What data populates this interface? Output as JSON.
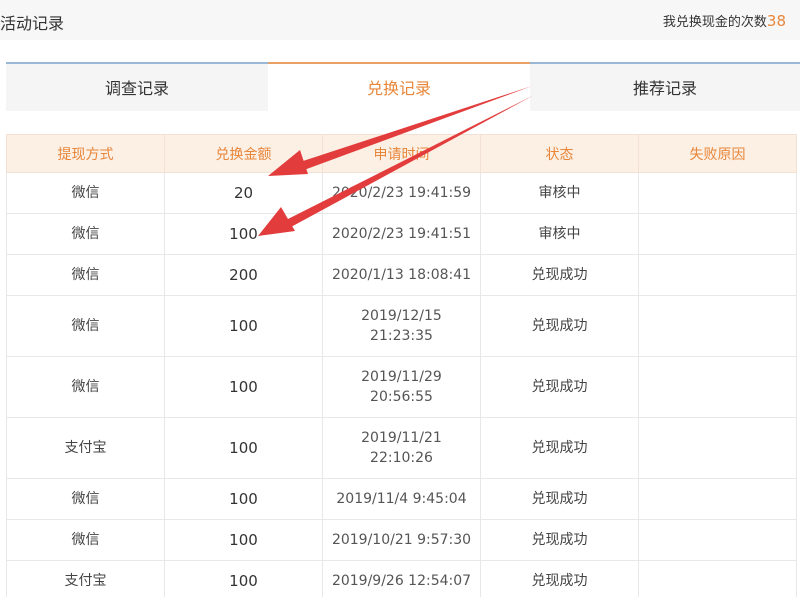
{
  "header": {
    "title": "活动记录",
    "count_label": "我兑换现金的次数",
    "count_value": "38"
  },
  "tabs": [
    {
      "label": "调查记录"
    },
    {
      "label": "兑换记录"
    },
    {
      "label": "推荐记录"
    }
  ],
  "table": {
    "columns": [
      "提现方式",
      "兑换金额",
      "申请时间",
      "状态",
      "失败原因"
    ],
    "rows": [
      {
        "method": "微信",
        "amount": "20",
        "time_line1": "2020/2/23 19:41:59",
        "time_line2": "",
        "status": "审核中",
        "reason": ""
      },
      {
        "method": "微信",
        "amount": "100",
        "time_line1": "2020/2/23 19:41:51",
        "time_line2": "",
        "status": "审核中",
        "reason": ""
      },
      {
        "method": "微信",
        "amount": "200",
        "time_line1": "2020/1/13 18:08:41",
        "time_line2": "",
        "status": "兑现成功",
        "reason": ""
      },
      {
        "method": "微信",
        "amount": "100",
        "time_line1": "2019/12/15",
        "time_line2": "21:23:35",
        "status": "兑现成功",
        "reason": ""
      },
      {
        "method": "微信",
        "amount": "100",
        "time_line1": "2019/11/29",
        "time_line2": "20:56:55",
        "status": "兑现成功",
        "reason": ""
      },
      {
        "method": "支付宝",
        "amount": "100",
        "time_line1": "2019/11/21",
        "time_line2": "22:10:26",
        "status": "兑现成功",
        "reason": ""
      },
      {
        "method": "微信",
        "amount": "100",
        "time_line1": "2019/11/4 9:45:04",
        "time_line2": "",
        "status": "兑现成功",
        "reason": ""
      },
      {
        "method": "微信",
        "amount": "100",
        "time_line1": "2019/10/21 9:57:30",
        "time_line2": "",
        "status": "兑现成功",
        "reason": ""
      },
      {
        "method": "支付宝",
        "amount": "100",
        "time_line1": "2019/9/26 12:54:07",
        "time_line2": "",
        "status": "兑现成功",
        "reason": ""
      }
    ]
  },
  "colors": {
    "accent": "#e8863a",
    "header_bg": "#fcefe4",
    "annotation_arrow": "#e23c3c"
  }
}
